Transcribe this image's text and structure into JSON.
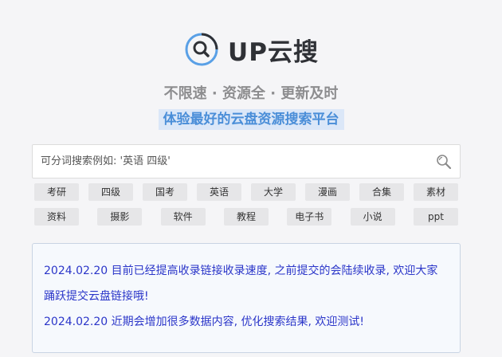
{
  "brand": {
    "name": "UP云搜",
    "icon": "search-logo-icon",
    "accent": "#4a8ed8"
  },
  "slogan": "不限速 · 资源全 · 更新及时",
  "subtitle": "体验最好的云盘资源搜索平台",
  "search": {
    "placeholder": "可分词搜索例如: '英语 四级'",
    "value": "",
    "icon": "search-icon"
  },
  "tags_row1": [
    "考研",
    "四级",
    "国考",
    "英语",
    "大学",
    "漫画",
    "合集",
    "素材"
  ],
  "tags_row2": [
    "资料",
    "摄影",
    "软件",
    "教程",
    "电子书",
    "小说",
    "ppt"
  ],
  "notices": [
    "2024.02.20 目前已经提高收录链接收录速度, 之前提交的会陆续收录, 欢迎大家踊跃提交云盘链接哦!",
    "2024.02.20 近期会增加很多数据内容, 优化搜索结果, 欢迎测试!"
  ]
}
